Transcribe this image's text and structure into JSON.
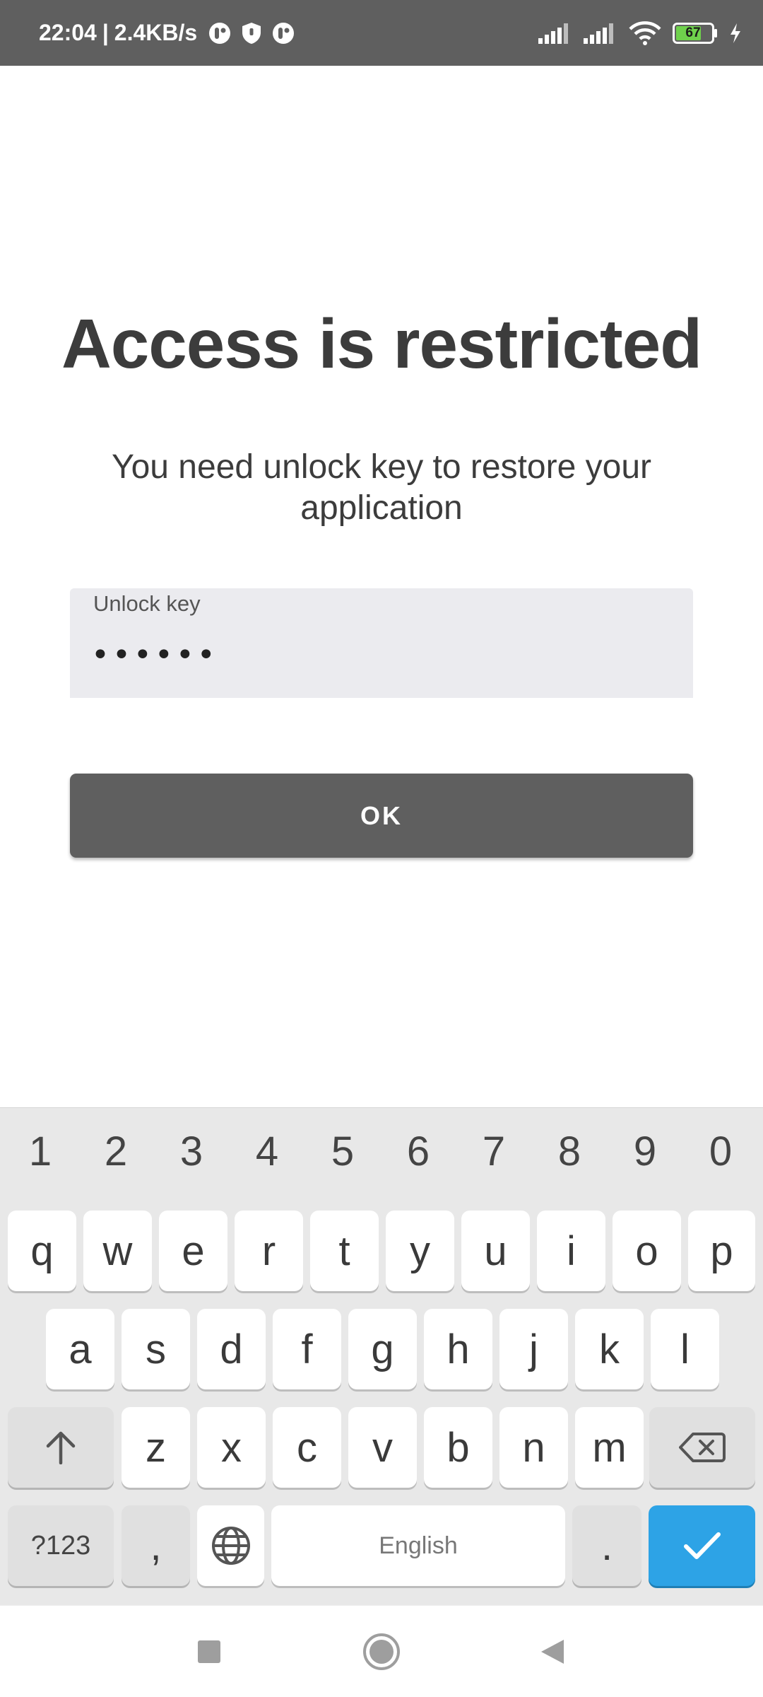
{
  "status_bar": {
    "time": "22:04",
    "separator": "|",
    "net_speed": "2.4KB/s",
    "battery_level": "67",
    "icons": [
      "app-notification-icon",
      "shield-icon",
      "app-notification-icon",
      "signal-icon",
      "signal-icon",
      "wifi-icon",
      "battery-icon",
      "charging-icon"
    ]
  },
  "main": {
    "title": "Access is restricted",
    "subtitle": "You need unlock key to restore your application",
    "unlock_field": {
      "label": "Unlock key",
      "value": "••••••"
    },
    "ok_button": "OK"
  },
  "keyboard": {
    "number_row": [
      "1",
      "2",
      "3",
      "4",
      "5",
      "6",
      "7",
      "8",
      "9",
      "0"
    ],
    "row1": [
      "q",
      "w",
      "e",
      "r",
      "t",
      "y",
      "u",
      "i",
      "o",
      "p"
    ],
    "row2": [
      "a",
      "s",
      "d",
      "f",
      "g",
      "h",
      "j",
      "k",
      "l"
    ],
    "row3": [
      "z",
      "x",
      "c",
      "v",
      "b",
      "n",
      "m"
    ],
    "symbols_key": "?123",
    "comma_key": ",",
    "space_label": "English",
    "period_key": ".",
    "accent_color": "#2da3e6"
  },
  "nav_bar": {
    "icons": [
      "recent-apps-icon",
      "home-icon",
      "back-icon"
    ]
  }
}
